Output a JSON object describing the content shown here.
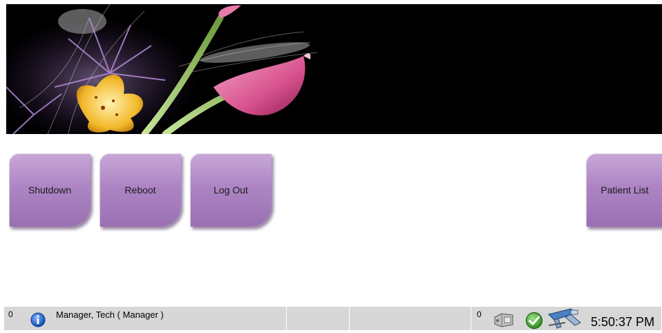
{
  "actions": {
    "shutdown_label": "Shutdown",
    "reboot_label": "Reboot",
    "logout_label": "Log Out",
    "patient_list_label": "Patient List"
  },
  "status_bar": {
    "left_count": "0",
    "user": "Manager, Tech ( Manager )",
    "right_count": "0",
    "time": "5:50:37 PM",
    "icons": [
      "info-icon",
      "media-drive-icon",
      "status-ok-check-icon",
      "gantry-device-icon"
    ]
  },
  "colors": {
    "button_purple": "#ad85c4",
    "status_bar_gray": "#d7d7d7",
    "banner_black": "#000000"
  }
}
